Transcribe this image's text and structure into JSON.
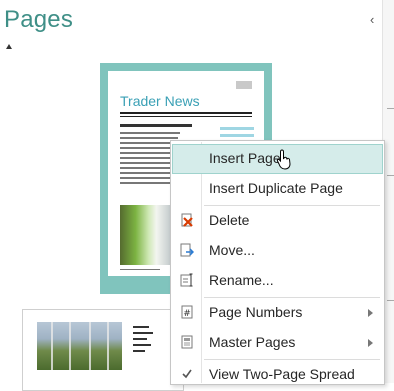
{
  "pane": {
    "title": "Pages",
    "collapse_glyph": "‹"
  },
  "thumbnails": [
    {
      "newsletter_title": "Trader News"
    },
    {}
  ],
  "context_menu": {
    "items": [
      {
        "label": "Insert Page",
        "icon": "insert-page-icon",
        "submenu": false,
        "highlighted": true
      },
      {
        "label": "Insert Duplicate Page",
        "icon": "",
        "submenu": false,
        "highlighted": false
      },
      {
        "label": "Delete",
        "icon": "delete-page-icon",
        "submenu": false,
        "highlighted": false
      },
      {
        "label": "Move...",
        "icon": "move-page-icon",
        "submenu": false,
        "highlighted": false
      },
      {
        "label": "Rename...",
        "icon": "rename-page-icon",
        "submenu": false,
        "highlighted": false
      },
      {
        "label": "Page Numbers",
        "icon": "page-numbers-icon",
        "submenu": true,
        "highlighted": false
      },
      {
        "label": "Master Pages",
        "icon": "master-pages-icon",
        "submenu": true,
        "highlighted": false
      },
      {
        "label": "View Two-Page Spread",
        "icon": "checkmark-icon",
        "submenu": false,
        "highlighted": false
      }
    ]
  },
  "colors": {
    "accent": "#3f8f87",
    "thumb_border": "#80c4bd",
    "menu_highlight": "#d5ecea",
    "delete_icon": "#d83b01"
  }
}
